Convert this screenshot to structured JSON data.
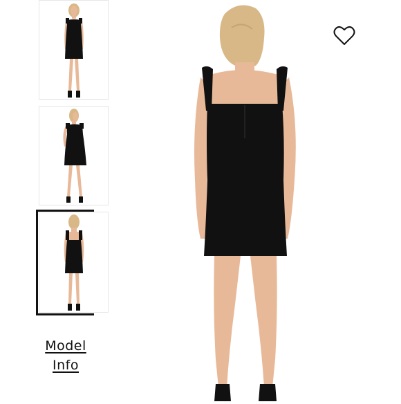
{
  "gallery": {
    "thumbnails": [
      {
        "view": "front"
      },
      {
        "view": "side"
      },
      {
        "view": "back",
        "selected": true
      }
    ]
  },
  "model_info": {
    "line1": "Model",
    "line2": "Info"
  },
  "main_image": {
    "view": "back",
    "dress_color": "#111111",
    "hair_color": "#d8b886",
    "skin_color": "#e8b998"
  },
  "wishlist": {
    "icon": "heart-icon"
  }
}
